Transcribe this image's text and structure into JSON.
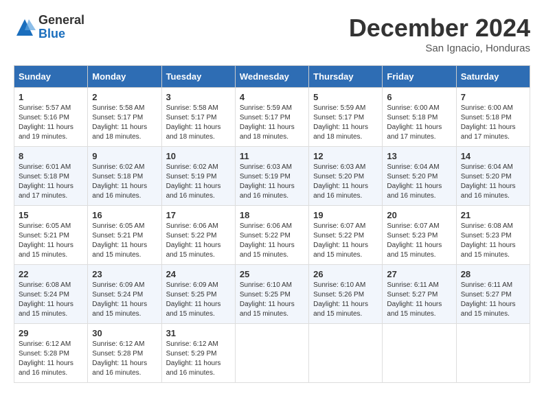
{
  "header": {
    "logo_general": "General",
    "logo_blue": "Blue",
    "month_title": "December 2024",
    "location": "San Ignacio, Honduras"
  },
  "days_of_week": [
    "Sunday",
    "Monday",
    "Tuesday",
    "Wednesday",
    "Thursday",
    "Friday",
    "Saturday"
  ],
  "weeks": [
    [
      {
        "day": "1",
        "lines": [
          "Sunrise: 5:57 AM",
          "Sunset: 5:16 PM",
          "Daylight: 11 hours",
          "and 19 minutes."
        ]
      },
      {
        "day": "2",
        "lines": [
          "Sunrise: 5:58 AM",
          "Sunset: 5:17 PM",
          "Daylight: 11 hours",
          "and 18 minutes."
        ]
      },
      {
        "day": "3",
        "lines": [
          "Sunrise: 5:58 AM",
          "Sunset: 5:17 PM",
          "Daylight: 11 hours",
          "and 18 minutes."
        ]
      },
      {
        "day": "4",
        "lines": [
          "Sunrise: 5:59 AM",
          "Sunset: 5:17 PM",
          "Daylight: 11 hours",
          "and 18 minutes."
        ]
      },
      {
        "day": "5",
        "lines": [
          "Sunrise: 5:59 AM",
          "Sunset: 5:17 PM",
          "Daylight: 11 hours",
          "and 18 minutes."
        ]
      },
      {
        "day": "6",
        "lines": [
          "Sunrise: 6:00 AM",
          "Sunset: 5:18 PM",
          "Daylight: 11 hours",
          "and 17 minutes."
        ]
      },
      {
        "day": "7",
        "lines": [
          "Sunrise: 6:00 AM",
          "Sunset: 5:18 PM",
          "Daylight: 11 hours",
          "and 17 minutes."
        ]
      }
    ],
    [
      {
        "day": "8",
        "lines": [
          "Sunrise: 6:01 AM",
          "Sunset: 5:18 PM",
          "Daylight: 11 hours",
          "and 17 minutes."
        ]
      },
      {
        "day": "9",
        "lines": [
          "Sunrise: 6:02 AM",
          "Sunset: 5:18 PM",
          "Daylight: 11 hours",
          "and 16 minutes."
        ]
      },
      {
        "day": "10",
        "lines": [
          "Sunrise: 6:02 AM",
          "Sunset: 5:19 PM",
          "Daylight: 11 hours",
          "and 16 minutes."
        ]
      },
      {
        "day": "11",
        "lines": [
          "Sunrise: 6:03 AM",
          "Sunset: 5:19 PM",
          "Daylight: 11 hours",
          "and 16 minutes."
        ]
      },
      {
        "day": "12",
        "lines": [
          "Sunrise: 6:03 AM",
          "Sunset: 5:20 PM",
          "Daylight: 11 hours",
          "and 16 minutes."
        ]
      },
      {
        "day": "13",
        "lines": [
          "Sunrise: 6:04 AM",
          "Sunset: 5:20 PM",
          "Daylight: 11 hours",
          "and 16 minutes."
        ]
      },
      {
        "day": "14",
        "lines": [
          "Sunrise: 6:04 AM",
          "Sunset: 5:20 PM",
          "Daylight: 11 hours",
          "and 16 minutes."
        ]
      }
    ],
    [
      {
        "day": "15",
        "lines": [
          "Sunrise: 6:05 AM",
          "Sunset: 5:21 PM",
          "Daylight: 11 hours",
          "and 15 minutes."
        ]
      },
      {
        "day": "16",
        "lines": [
          "Sunrise: 6:05 AM",
          "Sunset: 5:21 PM",
          "Daylight: 11 hours",
          "and 15 minutes."
        ]
      },
      {
        "day": "17",
        "lines": [
          "Sunrise: 6:06 AM",
          "Sunset: 5:22 PM",
          "Daylight: 11 hours",
          "and 15 minutes."
        ]
      },
      {
        "day": "18",
        "lines": [
          "Sunrise: 6:06 AM",
          "Sunset: 5:22 PM",
          "Daylight: 11 hours",
          "and 15 minutes."
        ]
      },
      {
        "day": "19",
        "lines": [
          "Sunrise: 6:07 AM",
          "Sunset: 5:22 PM",
          "Daylight: 11 hours",
          "and 15 minutes."
        ]
      },
      {
        "day": "20",
        "lines": [
          "Sunrise: 6:07 AM",
          "Sunset: 5:23 PM",
          "Daylight: 11 hours",
          "and 15 minutes."
        ]
      },
      {
        "day": "21",
        "lines": [
          "Sunrise: 6:08 AM",
          "Sunset: 5:23 PM",
          "Daylight: 11 hours",
          "and 15 minutes."
        ]
      }
    ],
    [
      {
        "day": "22",
        "lines": [
          "Sunrise: 6:08 AM",
          "Sunset: 5:24 PM",
          "Daylight: 11 hours",
          "and 15 minutes."
        ]
      },
      {
        "day": "23",
        "lines": [
          "Sunrise: 6:09 AM",
          "Sunset: 5:24 PM",
          "Daylight: 11 hours",
          "and 15 minutes."
        ]
      },
      {
        "day": "24",
        "lines": [
          "Sunrise: 6:09 AM",
          "Sunset: 5:25 PM",
          "Daylight: 11 hours",
          "and 15 minutes."
        ]
      },
      {
        "day": "25",
        "lines": [
          "Sunrise: 6:10 AM",
          "Sunset: 5:25 PM",
          "Daylight: 11 hours",
          "and 15 minutes."
        ]
      },
      {
        "day": "26",
        "lines": [
          "Sunrise: 6:10 AM",
          "Sunset: 5:26 PM",
          "Daylight: 11 hours",
          "and 15 minutes."
        ]
      },
      {
        "day": "27",
        "lines": [
          "Sunrise: 6:11 AM",
          "Sunset: 5:27 PM",
          "Daylight: 11 hours",
          "and 15 minutes."
        ]
      },
      {
        "day": "28",
        "lines": [
          "Sunrise: 6:11 AM",
          "Sunset: 5:27 PM",
          "Daylight: 11 hours",
          "and 15 minutes."
        ]
      }
    ],
    [
      {
        "day": "29",
        "lines": [
          "Sunrise: 6:12 AM",
          "Sunset: 5:28 PM",
          "Daylight: 11 hours",
          "and 16 minutes."
        ]
      },
      {
        "day": "30",
        "lines": [
          "Sunrise: 6:12 AM",
          "Sunset: 5:28 PM",
          "Daylight: 11 hours",
          "and 16 minutes."
        ]
      },
      {
        "day": "31",
        "lines": [
          "Sunrise: 6:12 AM",
          "Sunset: 5:29 PM",
          "Daylight: 11 hours",
          "and 16 minutes."
        ]
      },
      null,
      null,
      null,
      null
    ]
  ]
}
